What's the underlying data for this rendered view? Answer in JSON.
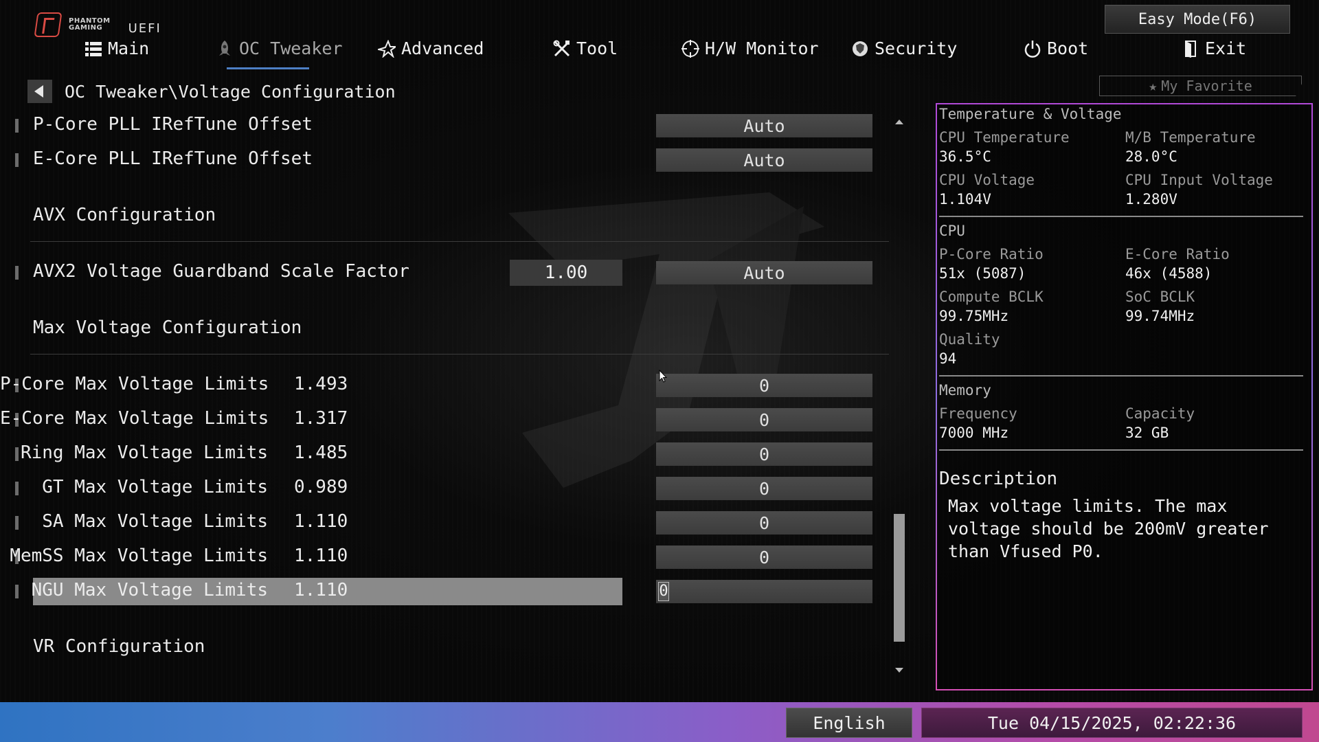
{
  "header": {
    "brand_line1": "PHANTOM",
    "brand_line2": "GAMING",
    "uefi_label": "UEFI",
    "easy_mode_label": "Easy Mode(F6)"
  },
  "nav": {
    "tabs": [
      {
        "label": "Main",
        "icon": "list-icon"
      },
      {
        "label": "OC Tweaker",
        "icon": "rocket-icon",
        "active": true
      },
      {
        "label": "Advanced",
        "icon": "star-icon"
      },
      {
        "label": "Tool",
        "icon": "tools-icon"
      },
      {
        "label": "H/W Monitor",
        "icon": "crosshair-icon"
      },
      {
        "label": "Security",
        "icon": "shield-icon"
      },
      {
        "label": "Boot",
        "icon": "power-icon"
      },
      {
        "label": "Exit",
        "icon": "exit-door-icon"
      }
    ]
  },
  "breadcrumb": "OC Tweaker\\Voltage Configuration",
  "favorite_label": "My Favorite",
  "settings": {
    "pcore_pll": {
      "label": "P-Core PLL IRefTune Offset",
      "value": "Auto"
    },
    "ecore_pll": {
      "label": "E-Core PLL IRefTune Offset",
      "value": "Auto"
    },
    "avx_section": "AVX Configuration",
    "avx2_guardband": {
      "label": "AVX2 Voltage Guardband Scale Factor",
      "current": "1.00",
      "value": "Auto"
    },
    "maxv_section": "Max Voltage Configuration",
    "limits": [
      {
        "label": "P-Core Max Voltage Limits",
        "current": "1.493",
        "value": "0"
      },
      {
        "label": "E-Core Max Voltage Limits",
        "current": "1.317",
        "value": "0"
      },
      {
        "label": "Ring Max Voltage Limits",
        "current": "1.485",
        "value": "0"
      },
      {
        "label": "GT Max Voltage Limits",
        "current": "0.989",
        "value": "0"
      },
      {
        "label": "SA Max Voltage Limits",
        "current": "1.110",
        "value": "0"
      },
      {
        "label": "MemSS Max Voltage Limits",
        "current": "1.110",
        "value": "0"
      },
      {
        "label": "NGU Max Voltage Limits",
        "current": "1.110",
        "value": "0"
      }
    ],
    "vr_section": "VR Configuration"
  },
  "panel": {
    "title": "Temperature & Voltage",
    "cpu_temp_label": "CPU Temperature",
    "cpu_temp": "36.5°C",
    "mb_temp_label": "M/B Temperature",
    "mb_temp": "28.0°C",
    "cpu_voltage_label": "CPU Voltage",
    "cpu_voltage": "1.104V",
    "cpu_input_label": "CPU Input Voltage",
    "cpu_input": "1.280V",
    "cpu_title": "CPU",
    "pcore_ratio_label": "P-Core Ratio",
    "pcore_ratio": "51x (5087)",
    "ecore_ratio_label": "E-Core Ratio",
    "ecore_ratio": "46x (4588)",
    "compute_bclk_label": "Compute BCLK",
    "compute_bclk": "99.75MHz",
    "soc_bclk_label": "SoC BCLK",
    "soc_bclk": "99.74MHz",
    "quality_label": "Quality",
    "quality": "94",
    "memory_title": "Memory",
    "freq_label": "Frequency",
    "freq": "7000 MHz",
    "capacity_label": "Capacity",
    "capacity": "32 GB",
    "desc_title": "Description",
    "desc_text": "Max voltage limits. The max voltage should be 200mV greater than Vfused P0."
  },
  "footer": {
    "language": "English",
    "datetime": "Tue 04/15/2025, 02:22:36"
  },
  "colors": {
    "accent_blue": "#4d7fc4",
    "panel_border": "#b24ad8",
    "highlight": "#8a8a8a"
  }
}
